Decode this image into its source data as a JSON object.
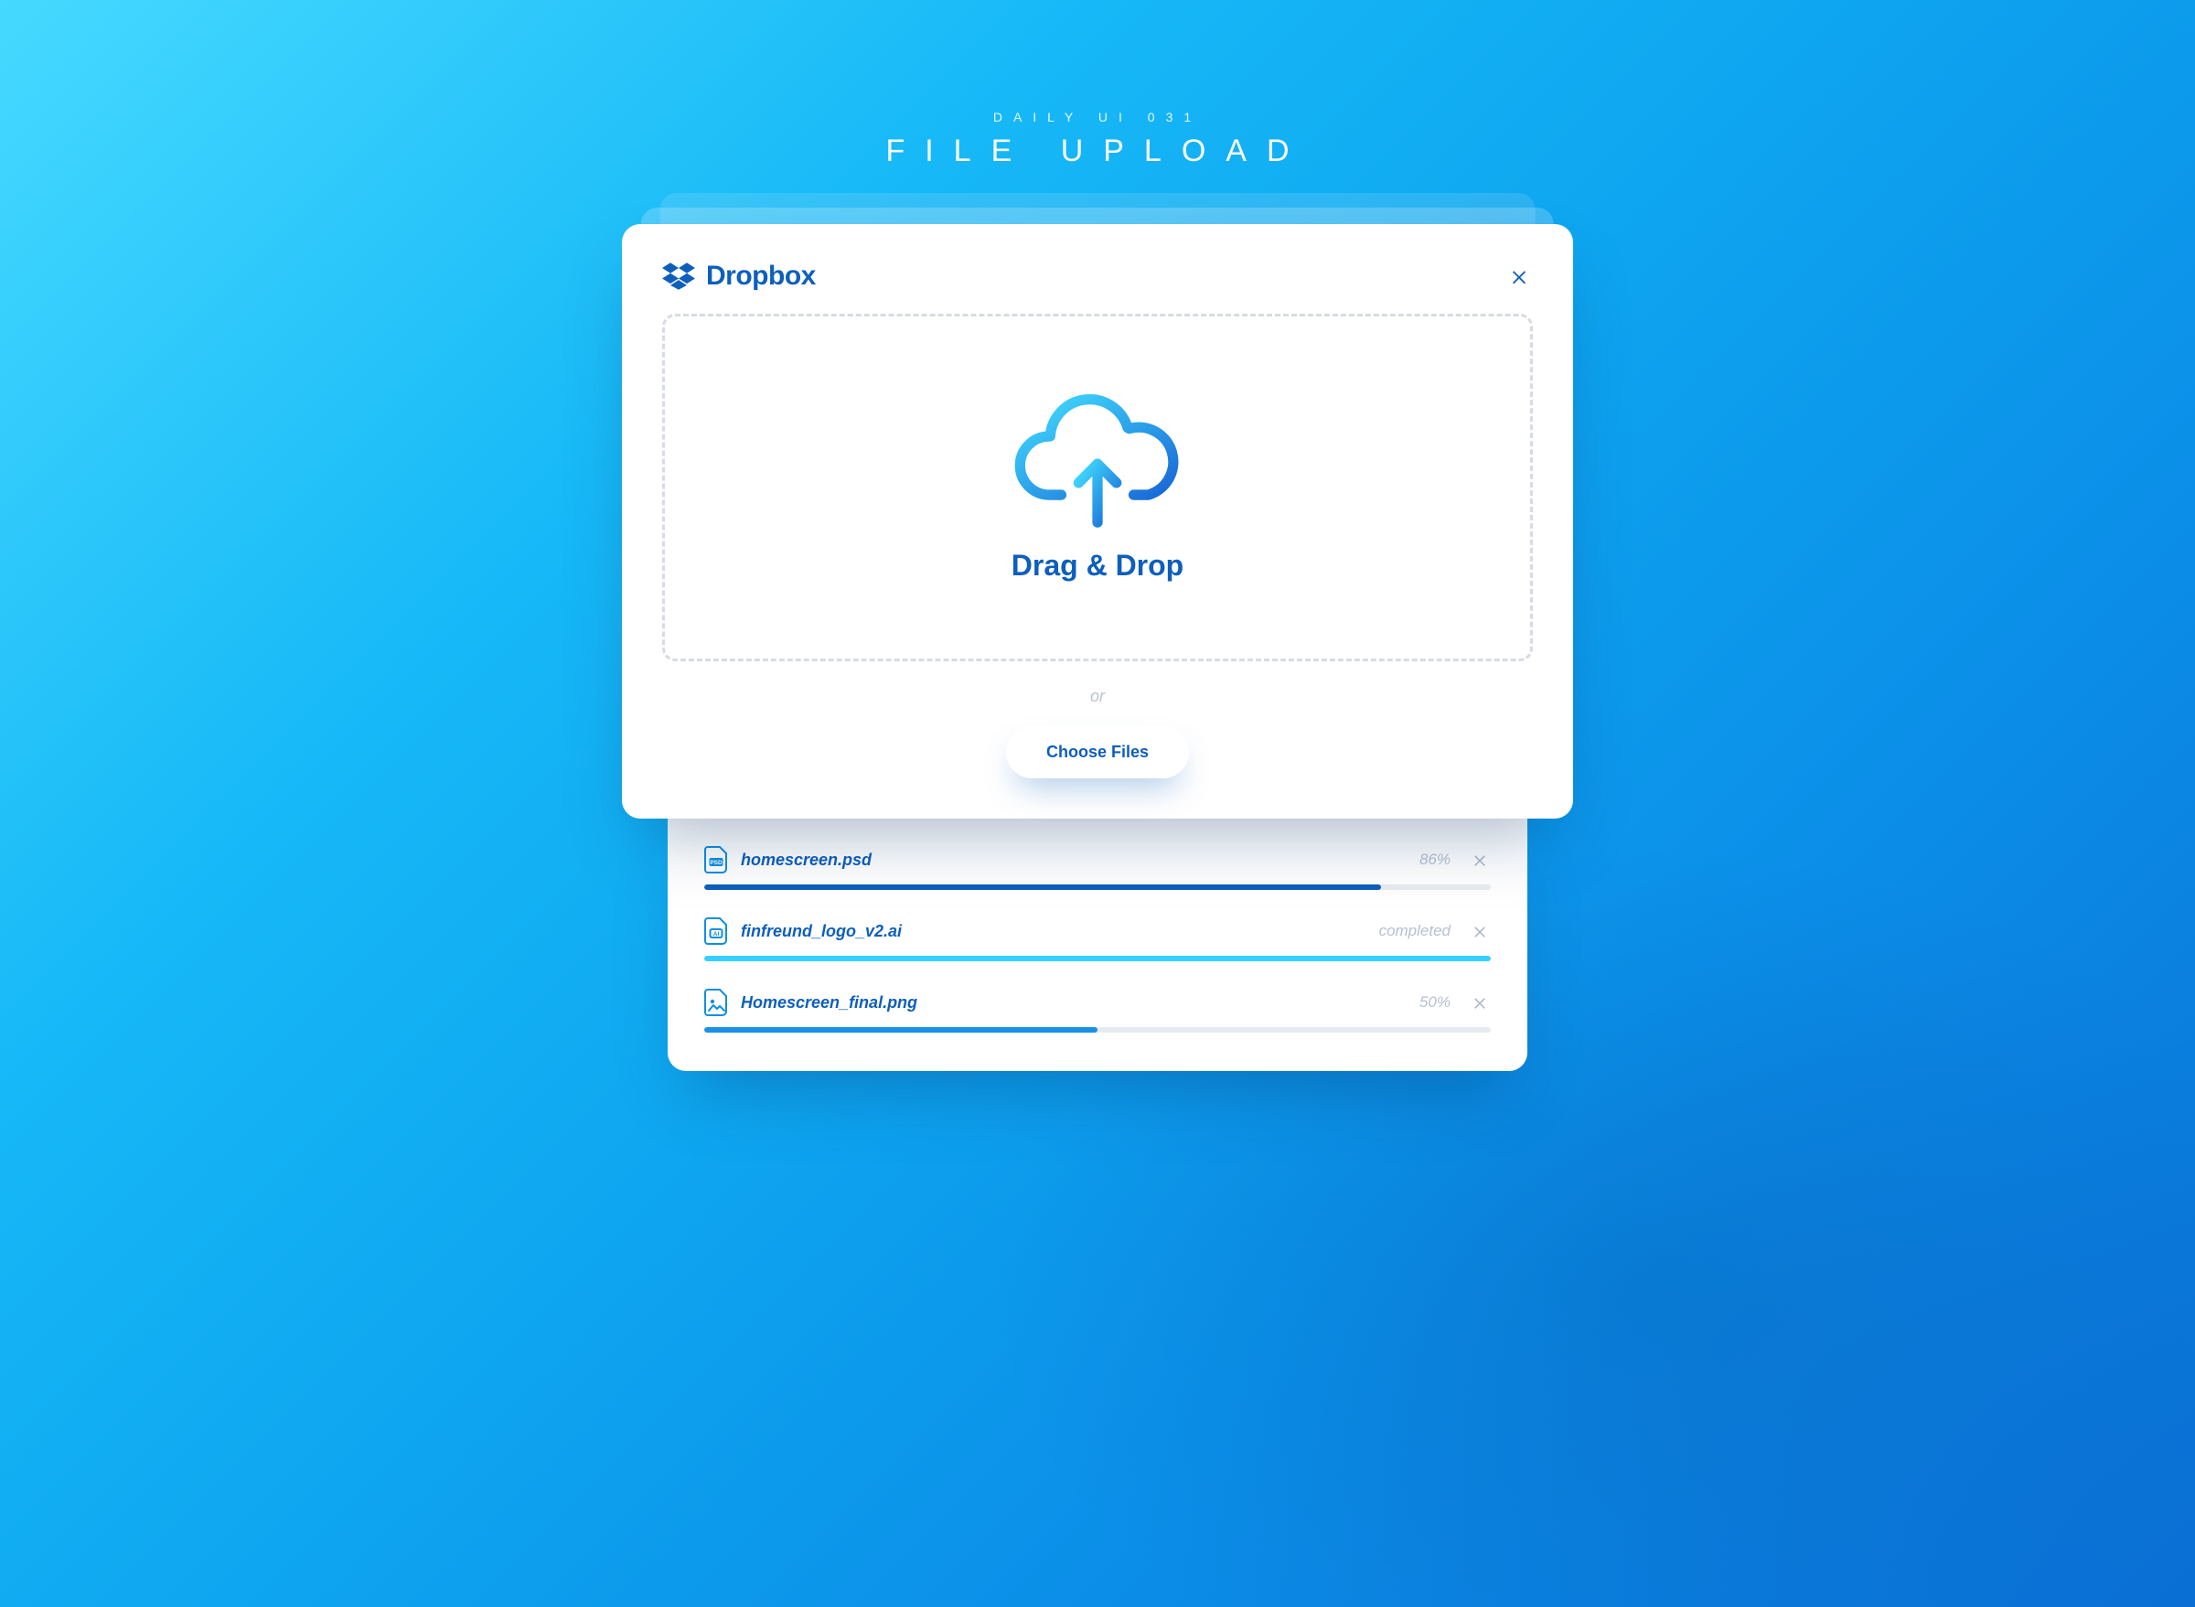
{
  "header": {
    "eyebrow": "DAILY UI 031",
    "title": "FILE UPLOAD"
  },
  "dialog": {
    "brand": "Dropbox",
    "dropzone_label": "Drag & Drop",
    "or_label": "or",
    "choose_label": "Choose Files"
  },
  "files": [
    {
      "name": "homescreen.psd",
      "status": "86%",
      "progress": 86,
      "type": "psd",
      "bar_class": "bar-blue"
    },
    {
      "name": "finfreund_logo_v2.ai",
      "status": "completed",
      "progress": 100,
      "type": "ai",
      "bar_class": "bar-cyan"
    },
    {
      "name": "Homescreen_final.png",
      "status": "50%",
      "progress": 50,
      "type": "image",
      "bar_class": "bar-mid"
    }
  ],
  "colors": {
    "brand": "#0e5fbc",
    "accent_cyan": "#35d0ff",
    "accent_blue": "#0e5fbc"
  }
}
